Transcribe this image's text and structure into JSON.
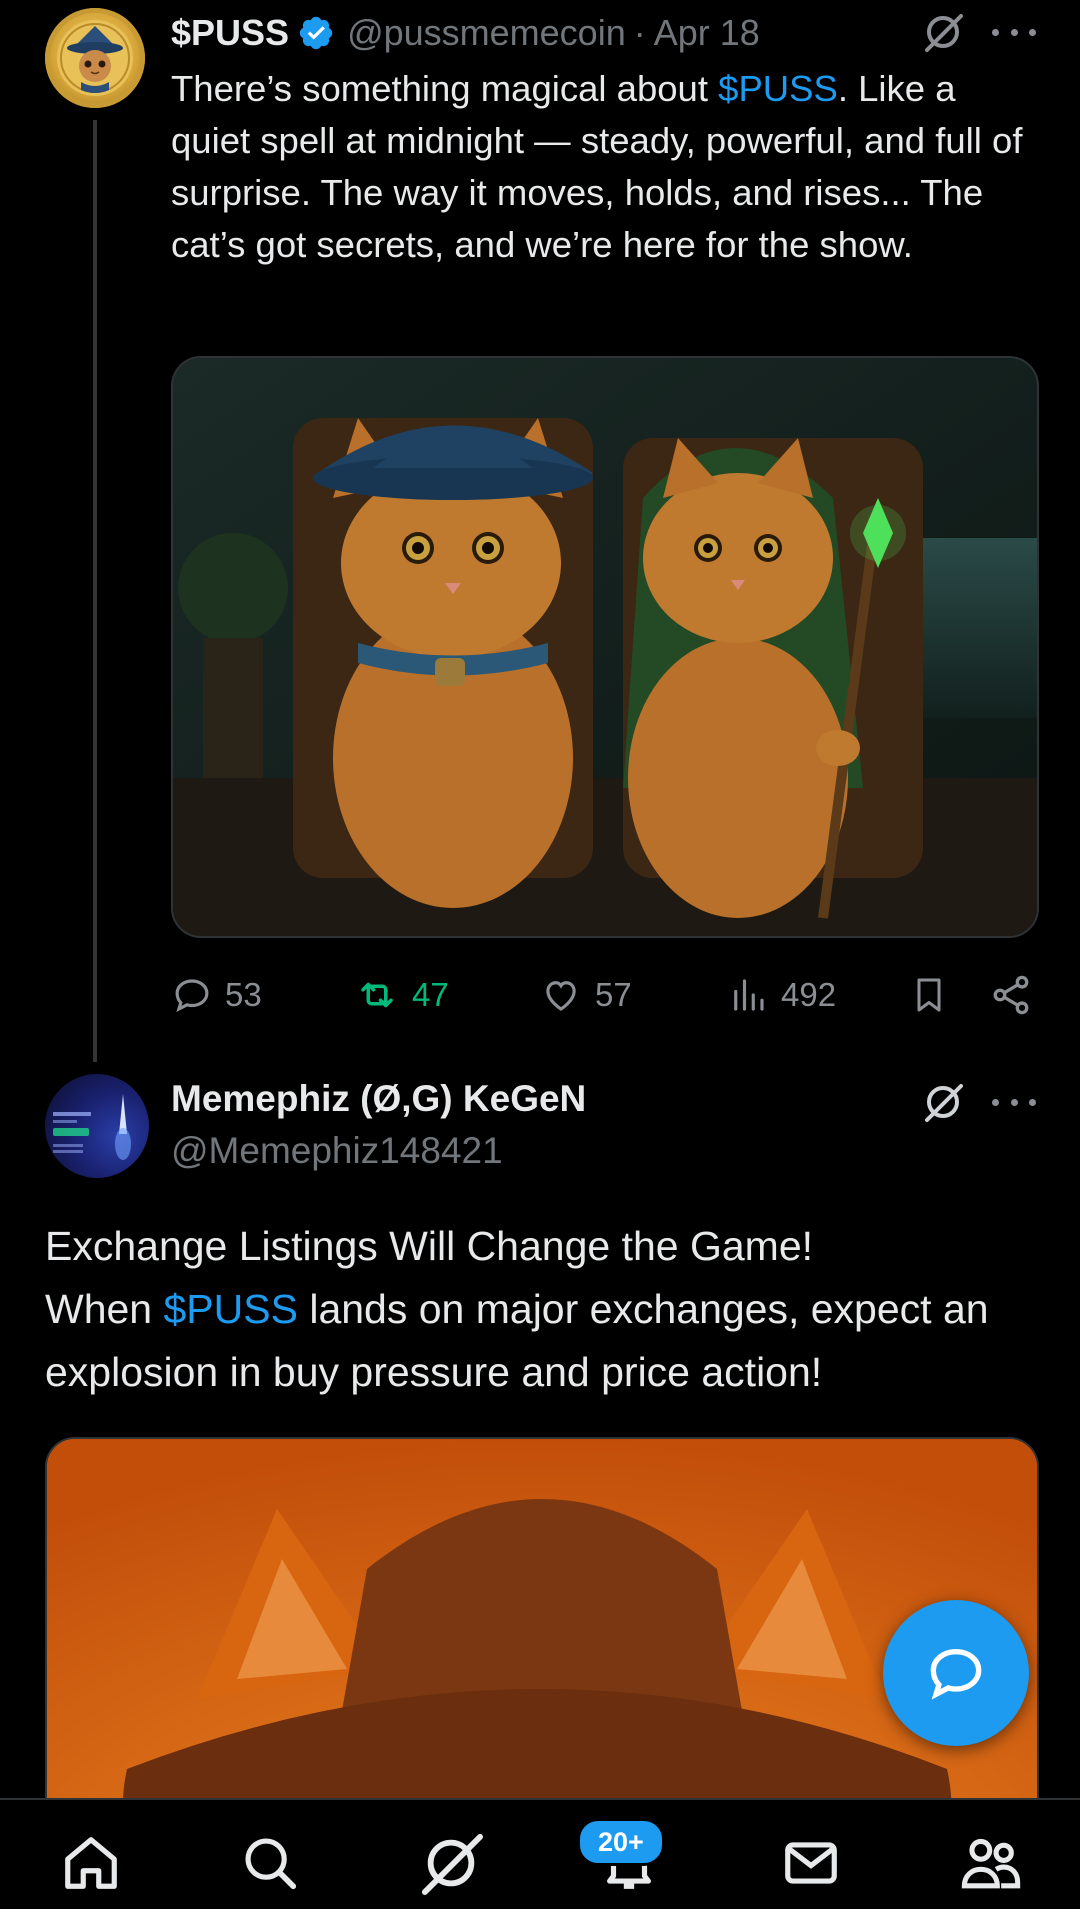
{
  "tweet1": {
    "author_name": "$PUSS",
    "handle": "@pussmemecoin",
    "separator": "·",
    "time": "Apr 18",
    "text_before": "There’s something magical about ",
    "cashtag": "$PUSS",
    "text_after": ". Like a quiet spell at midnight — steady, powerful, and full of surprise. The way it moves, holds, and rises... The cat’s got secrets, and we’re here for the show.",
    "media_alt": "Two orange cats dressed as wizards sitting on chairs by the sea",
    "stats": {
      "replies": "53",
      "reposts": "47",
      "likes": "57",
      "views": "492"
    }
  },
  "tweet2": {
    "author_name": "Memephiz (Ø,G) KeGeN",
    "handle": "@Memephiz148421",
    "text_line1": "Exchange Listings Will Change the Game!",
    "text_before": "When ",
    "cashtag": "$PUSS",
    "text_after": " lands on major exchanges, expect an explosion in buy pressure and price action!",
    "media_alt": "Orange cat wearing a brown hat"
  },
  "notifications_badge": "20+",
  "colors": {
    "accent": "#1d9bf0",
    "repost_green": "#00ba7c",
    "muted": "#71767b"
  }
}
